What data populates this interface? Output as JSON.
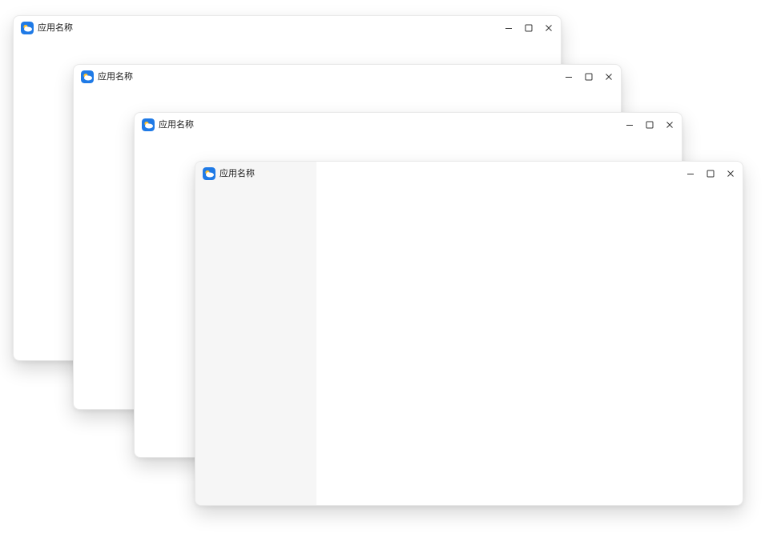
{
  "windows": [
    {
      "title": "应用名称",
      "has_sidebar": false
    },
    {
      "title": "应用名称",
      "has_sidebar": false
    },
    {
      "title": "应用名称",
      "has_sidebar": false
    },
    {
      "title": "应用名称",
      "has_sidebar": true
    }
  ],
  "icons": {
    "app": "weather-cloud-icon",
    "minimize": "minimize-icon",
    "maximize": "maximize-icon",
    "close": "close-icon"
  },
  "colors": {
    "icon_blue": "#1f7ae6",
    "icon_sun": "#ffc12e",
    "sidebar_bg": "#f6f6f6",
    "window_bg": "#ffffff",
    "text": "#1a1a1a"
  }
}
